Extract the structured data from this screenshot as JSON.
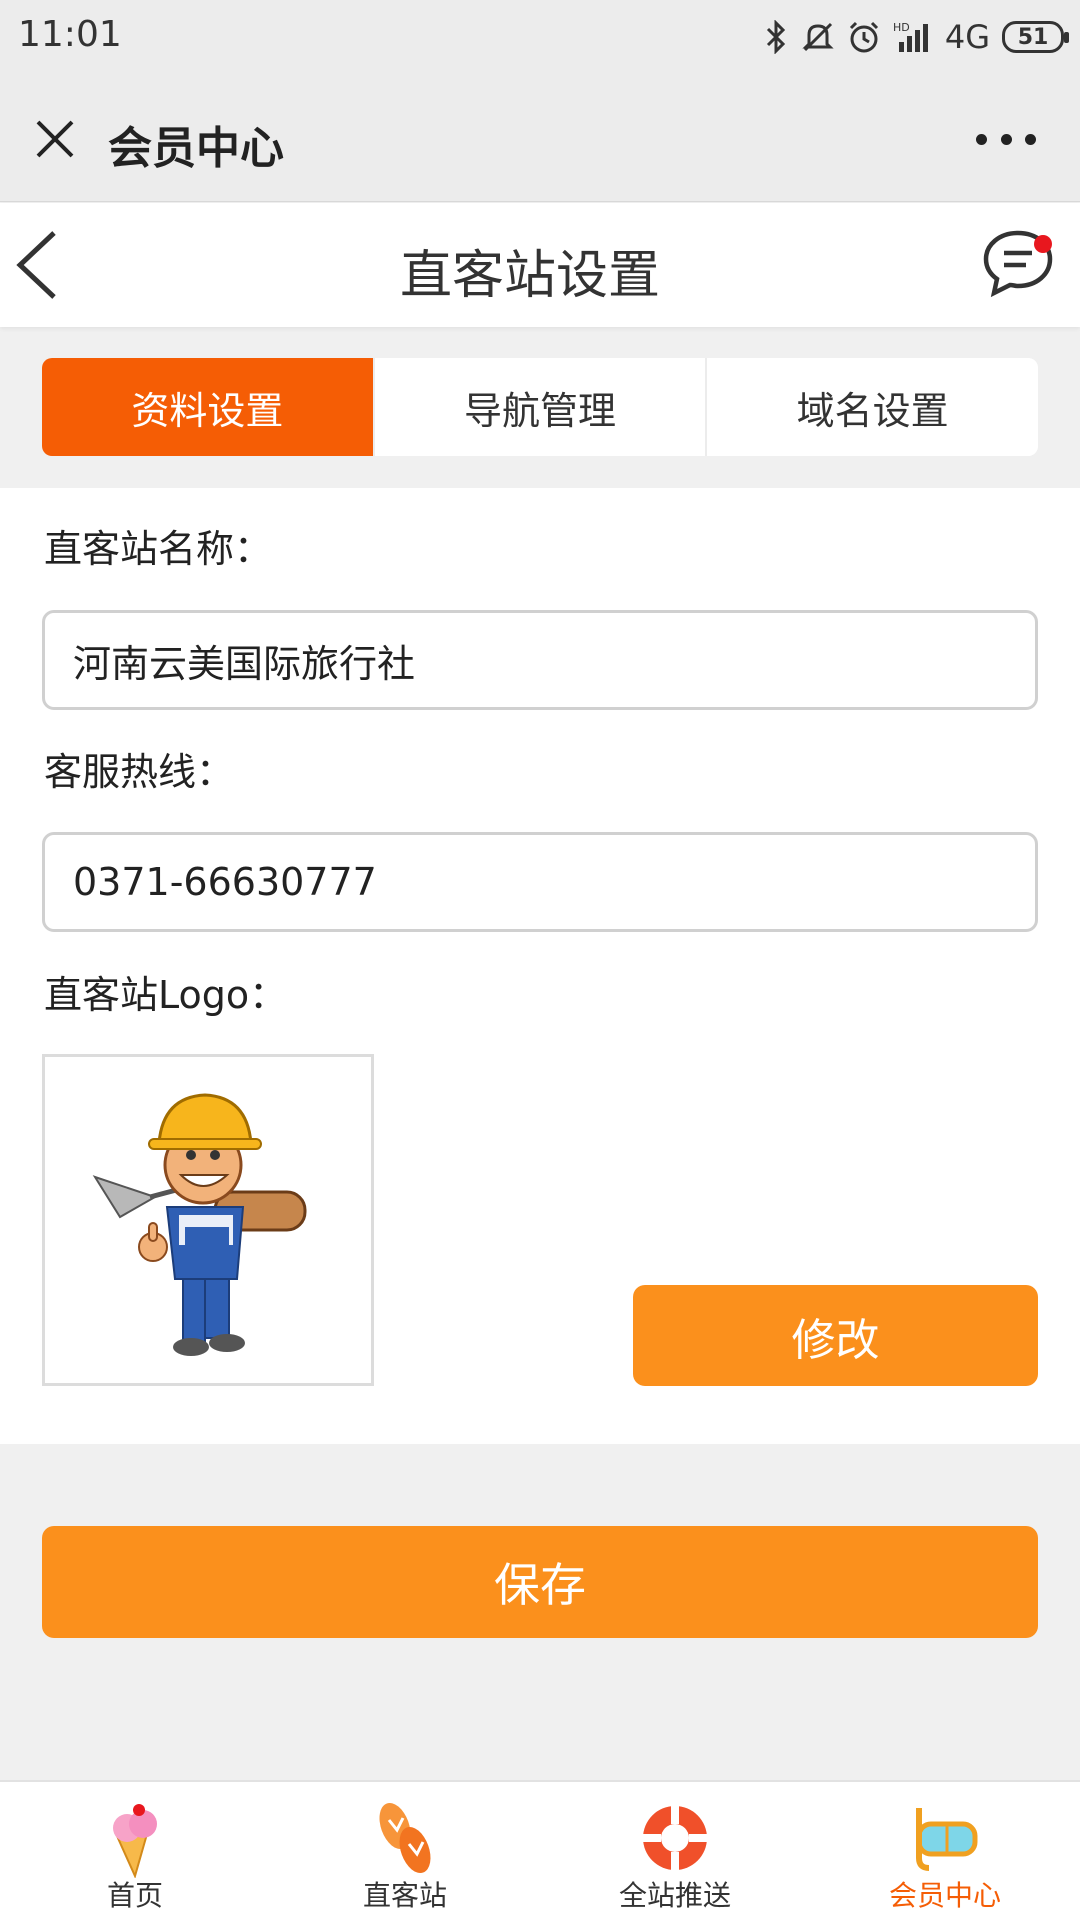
{
  "status_bar": {
    "time": "11:01",
    "network": "4G",
    "hd": "HD",
    "battery": "51"
  },
  "browser": {
    "title": "会员中心",
    "close_icon": "close-icon",
    "more_icon": "more-dots-icon"
  },
  "header": {
    "title": "直客站设置",
    "back_icon": "back-chevron-icon",
    "message_icon": "message-icon",
    "notification_color": "#e8171e"
  },
  "tabs": [
    {
      "label": "资料设置",
      "active": true
    },
    {
      "label": "导航管理",
      "active": false
    },
    {
      "label": "域名设置",
      "active": false
    }
  ],
  "form": {
    "site_name_label": "直客站名称：",
    "site_name_value": "河南云美国际旅行社",
    "hotline_label": "客服热线：",
    "hotline_value": "0371-66630777",
    "logo_label": "直客站Logo：",
    "logo_image": "cartoon-worker-logo",
    "modify_label": "修改"
  },
  "save_label": "保存",
  "colors": {
    "accent": "#f55d05",
    "button": "#fb901c"
  },
  "bottom_nav": [
    {
      "label": "首页",
      "icon": "ice-cream-icon",
      "active": false
    },
    {
      "label": "直客站",
      "icon": "flip-flops-icon",
      "active": false
    },
    {
      "label": "全站推送",
      "icon": "lifebuoy-icon",
      "active": false
    },
    {
      "label": "会员中心",
      "icon": "diving-mask-icon",
      "active": true
    }
  ]
}
